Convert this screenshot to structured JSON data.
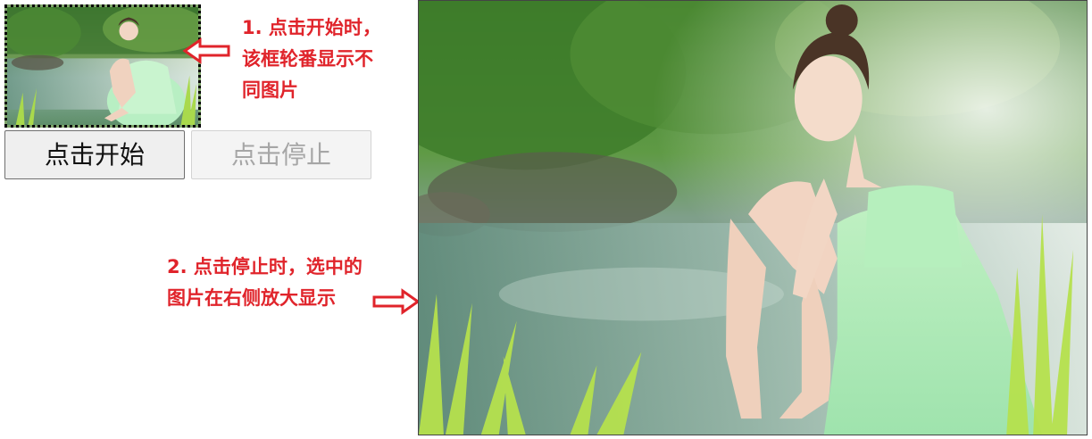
{
  "carousel": {
    "image_alt": "girl in green dress by a stream"
  },
  "buttons": {
    "start_label": "点击开始",
    "stop_label": "点击停止",
    "stop_disabled": true
  },
  "annotations": {
    "note1_lines": [
      "1. 点击开始时，",
      "该框轮番显示不",
      "同图片"
    ],
    "note2_lines": [
      "2. 点击停止时，选中的",
      "图片在右侧放大显示"
    ]
  },
  "display": {
    "image_alt": "enlarged selected photo"
  },
  "colors": {
    "annotation_red": "#e0242b",
    "frame_border": "#000000",
    "button_bg": "#efefef"
  },
  "icons": {
    "arrow_left": "left-outline-arrow",
    "arrow_right": "right-outline-arrow"
  }
}
